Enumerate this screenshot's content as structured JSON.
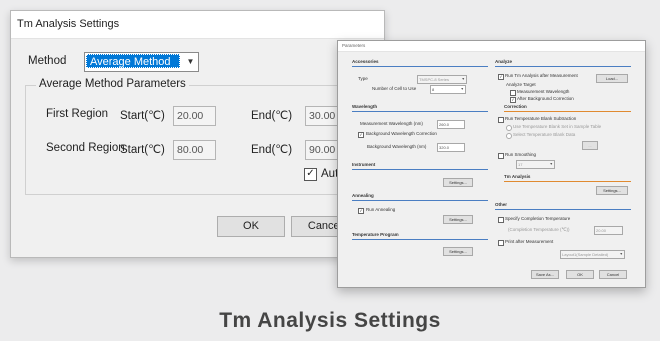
{
  "tm_window": {
    "title": "Tm Analysis Settings",
    "method_label": "Method",
    "method_value": "Average Method",
    "group_title": "Average Method Parameters",
    "first_region_label": "First Region",
    "second_region_label": "Second Region",
    "start_label": "Start(℃)",
    "end_label": "End(℃)",
    "first_start": "20.00",
    "first_end": "30.00",
    "second_start": "80.00",
    "second_end": "90.00",
    "auto_label": "Auto",
    "auto_checked": "✓",
    "ok_label": "OK",
    "cancel_label": "Cancel"
  },
  "params_window": {
    "title": "Parameters",
    "accessories": {
      "heading": "Accessories",
      "type_label": "Type",
      "type_value": "TMSPC-8 Series",
      "cells_label": "Number of Cell to Use",
      "cells_value": "8"
    },
    "wavelength": {
      "heading": "Wavelength",
      "measurement_label": "Measurement Wavelength (nm)",
      "measurement_value": "260.0",
      "bg_correction_label": "Background Wavelength Correction",
      "bg_correction_checked": "✓",
      "bg_wavelength_label": "Background Wavelength (nm)",
      "bg_wavelength_value": "320.0"
    },
    "instrument": {
      "heading": "Instrument",
      "settings_label": "Settings..."
    },
    "annealing": {
      "heading": "Annealing",
      "run_label": "Run Annealing",
      "run_checked": "✓",
      "settings_label": "Settings..."
    },
    "temperature_program": {
      "heading": "Temperature Program",
      "settings_label": "Settings..."
    },
    "analyze": {
      "heading": "Analyze",
      "run_tm_label": "Run Tm Analysis after Measurement",
      "run_tm_checked": "✓",
      "load_label": "Load...",
      "target_label": "Analyze Target",
      "measurement_wl_label": "Measurement Wavelength",
      "after_bg_label": "After Background Correction",
      "after_bg_checked": "✓"
    },
    "correction": {
      "heading": "Correction",
      "blank_sub_label": "Run Temperature Blank Subtraction",
      "use_blank_label": "Use Temperature Blank Set in Sample Table",
      "select_blank_label": "Select Temperature Blank Data",
      "browse_label": "...",
      "smoothing_label": "Run Smoothing",
      "smoothing_value": "17"
    },
    "tm_analysis": {
      "heading": "Tm Analysis",
      "settings_label": "Settings..."
    },
    "other": {
      "heading": "Other",
      "specify_label": "Specify Completion Temperature",
      "completion_label": "(Completion Temperature (℃))",
      "completion_value": "20.00",
      "print_label": "Print after Measurement",
      "layout_value": "Layout1(Sample Detailed)"
    },
    "buttons": {
      "save_as": "Save As...",
      "ok": "OK",
      "cancel": "Cancel"
    }
  },
  "caption": "Tm Analysis Settings"
}
